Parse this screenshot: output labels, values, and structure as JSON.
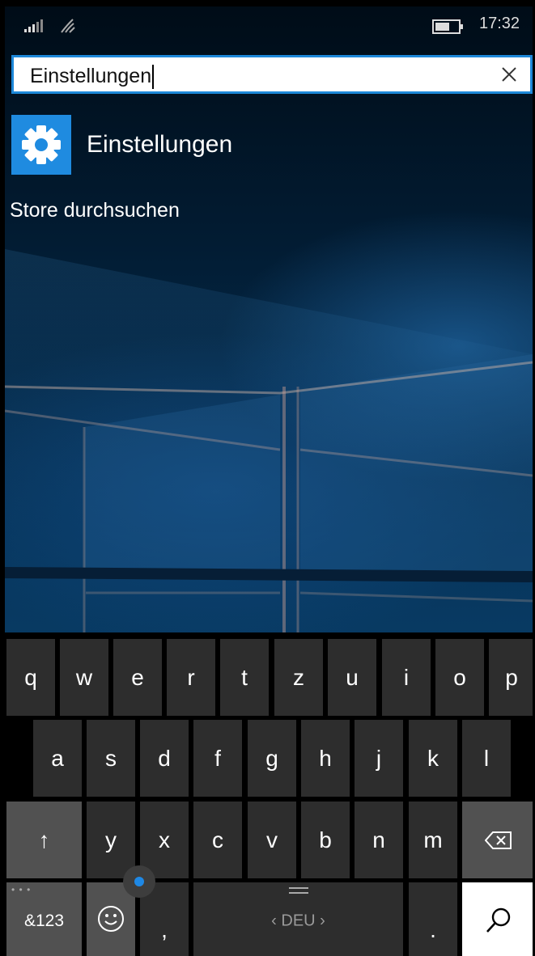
{
  "status": {
    "time": "17:32"
  },
  "search": {
    "query": "Einstellungen"
  },
  "results": {
    "app_label": "Einstellungen",
    "store_link": "Store durchsuchen"
  },
  "keyboard": {
    "row1": [
      "q",
      "w",
      "e",
      "r",
      "t",
      "z",
      "u",
      "i",
      "o",
      "p"
    ],
    "row2": [
      "a",
      "s",
      "d",
      "f",
      "g",
      "h",
      "j",
      "k",
      "l"
    ],
    "row3": [
      "y",
      "x",
      "c",
      "v",
      "b",
      "n",
      "m"
    ],
    "shift": "↑",
    "numbers": "&123",
    "dots": "• • •",
    "comma": ",",
    "language": "‹ DEU ›",
    "period": ".",
    "emoji_icon": "smiley-icon",
    "backspace_icon": "backspace-icon",
    "search_icon": "search-icon"
  },
  "colors": {
    "accent": "#1f8be0",
    "key": "#2d2d2d",
    "key_alt": "#515151"
  }
}
